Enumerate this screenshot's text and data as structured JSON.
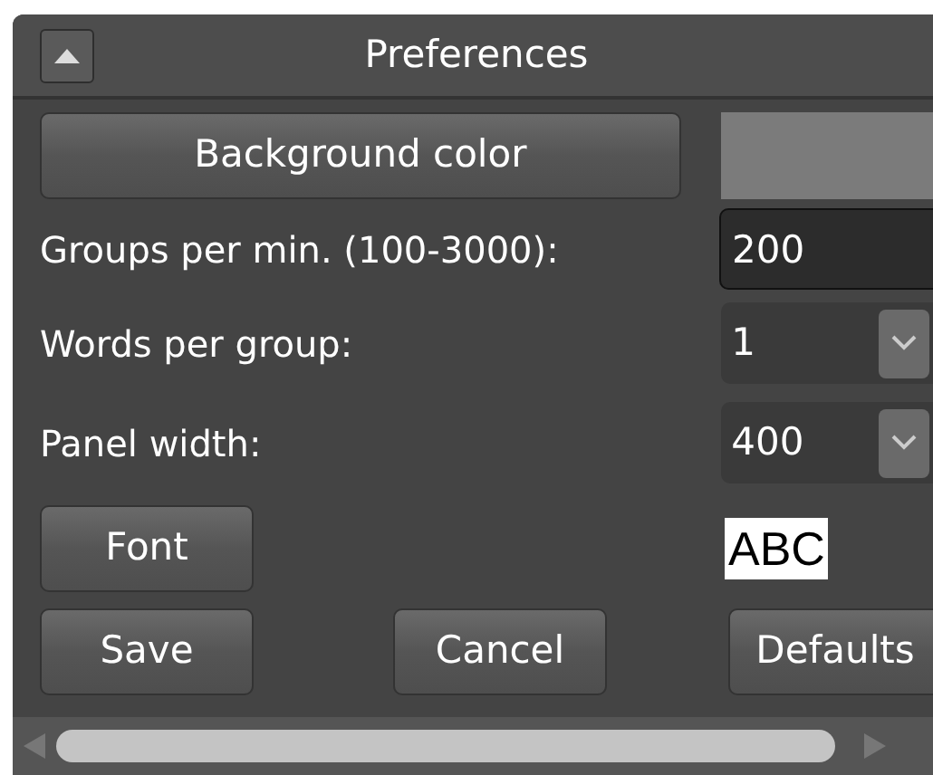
{
  "window": {
    "title": "Preferences"
  },
  "background_button": {
    "label": "Background color",
    "color": "#7b7b7b"
  },
  "fields": [
    {
      "label": "Groups per min. (100-3000):",
      "value": "200",
      "kind": "text"
    },
    {
      "label": "Words per group:",
      "value": "1",
      "kind": "dropdown"
    },
    {
      "label": "Panel width:",
      "value": "400",
      "kind": "dropdown"
    }
  ],
  "font_button": "Font",
  "font_preview": "ABC",
  "buttons": [
    "Save",
    "Cancel",
    "Defaults"
  ]
}
